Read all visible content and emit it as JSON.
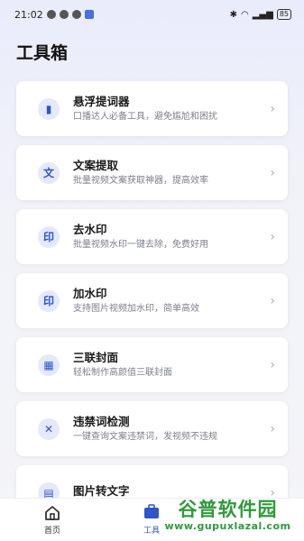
{
  "status_bar": {
    "time": "21:02",
    "battery": "85"
  },
  "header": {
    "title": "工具箱"
  },
  "tools": [
    {
      "icon": "teleprompter-icon",
      "glyph": "▮",
      "title": "悬浮提词器",
      "subtitle": "口播达人必备工具，避免尴尬和困扰"
    },
    {
      "icon": "text-extract-icon",
      "glyph": "文",
      "title": "文案提取",
      "subtitle": "批量视频文案获取神器，提高效率"
    },
    {
      "icon": "remove-watermark-icon",
      "glyph": "印",
      "title": "去水印",
      "subtitle": "批量视频水印一键去除，免费好用"
    },
    {
      "icon": "add-watermark-icon",
      "glyph": "印",
      "title": "加水印",
      "subtitle": "支持图片视频加水印，简单高效"
    },
    {
      "icon": "triple-cover-icon",
      "glyph": "▦",
      "title": "三联封面",
      "subtitle": "轻松制作高颜值三联封面"
    },
    {
      "icon": "banned-word-icon",
      "glyph": "✕",
      "title": "违禁词检测",
      "subtitle": "一键查询文案违禁词，发视频不违规"
    },
    {
      "icon": "image-to-text-icon",
      "glyph": "▤",
      "title": "图片转文字",
      "subtitle": ""
    }
  ],
  "bottom_nav": {
    "home_label": "首页",
    "tools_label": "工具"
  },
  "watermark": {
    "title": "谷普软件园",
    "url": "www.gupuxlazal.com"
  },
  "colors": {
    "accent": "#2f55c8",
    "watermark_green": "#2f9a3a"
  }
}
